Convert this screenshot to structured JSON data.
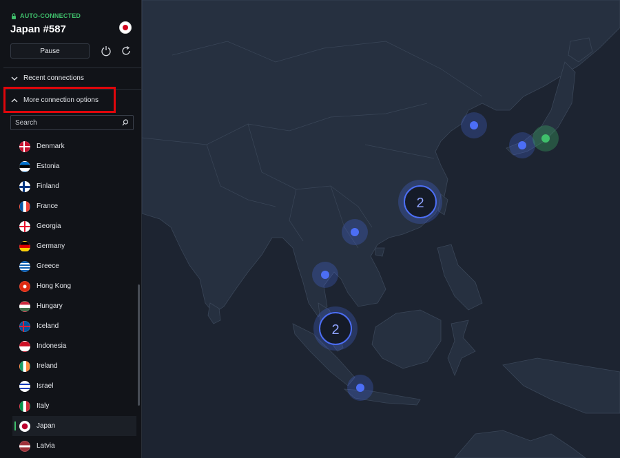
{
  "connection": {
    "status": "AUTO-CONNECTED",
    "server": "Japan #587",
    "pause_label": "Pause"
  },
  "sections": {
    "recent": "Recent connections",
    "more_options": "More connection options"
  },
  "search": {
    "placeholder": "Search"
  },
  "countries": [
    {
      "name": "Denmark",
      "flag": "denmark"
    },
    {
      "name": "Estonia",
      "flag": "estonia"
    },
    {
      "name": "Finland",
      "flag": "finland"
    },
    {
      "name": "France",
      "flag": "france"
    },
    {
      "name": "Georgia",
      "flag": "georgia"
    },
    {
      "name": "Germany",
      "flag": "germany"
    },
    {
      "name": "Greece",
      "flag": "greece"
    },
    {
      "name": "Hong Kong",
      "flag": "hong-kong"
    },
    {
      "name": "Hungary",
      "flag": "hungary"
    },
    {
      "name": "Iceland",
      "flag": "iceland"
    },
    {
      "name": "Indonesia",
      "flag": "indonesia"
    },
    {
      "name": "Ireland",
      "flag": "ireland"
    },
    {
      "name": "Israel",
      "flag": "israel"
    },
    {
      "name": "Italy",
      "flag": "italy"
    },
    {
      "name": "Japan",
      "flag": "japan",
      "selected": true
    },
    {
      "name": "Latvia",
      "flag": "latvia"
    }
  ],
  "map": {
    "cluster_counts": [
      "2",
      "2"
    ]
  },
  "colors": {
    "accent_green": "#3fbf6b",
    "marker_blue": "#4c6ef5",
    "highlight_red": "#e0060b"
  }
}
